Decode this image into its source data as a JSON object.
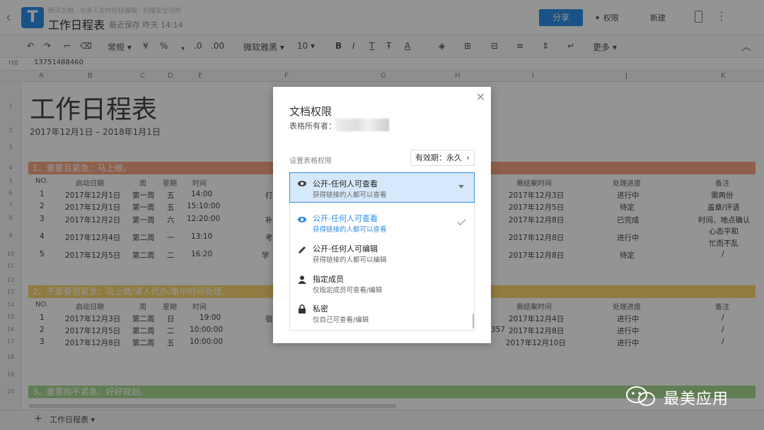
{
  "header": {
    "breadcrumb": "腾讯文档 · 与多人实时在线编辑 · 扫描安全可控",
    "title": "工作日程表",
    "save_status": "最近保存 昨天 14:14",
    "share_label": "分享",
    "permission_label": "权限",
    "new_label": "新建"
  },
  "toolbar": {
    "format": "常规",
    "currency": "¥",
    "percent": "%",
    "comma": "❟",
    "dec_decrease": ".0",
    "dec_increase": ".00",
    "font": "微软雅黑",
    "font_size": "10",
    "bold": "B",
    "italic": "I",
    "underline": "T",
    "strike": "Ŧ",
    "font_color": "A",
    "more": "更多"
  },
  "formula_bar": {
    "cell_ref": "H8",
    "value": "13751488460"
  },
  "columns": [
    "A",
    "B",
    "C",
    "D",
    "E",
    "F",
    "G",
    "H",
    "I",
    "J",
    "K"
  ],
  "rows": [
    "1",
    "2",
    "3",
    "4",
    "5",
    "6",
    "7",
    "8",
    "9",
    "10",
    "11",
    "12",
    "13",
    "14",
    "15",
    "16",
    "17",
    "18",
    "19",
    "20"
  ],
  "sheet": {
    "title": "工作日程表",
    "range": "2017年12月1日 – 2018年1月1日",
    "section1": "1、重要且紧急：马上做。",
    "section2": "2、不重要但紧急：马上做/请人代办/集中时间处理。",
    "section3": "3、重要而不紧急：好好规划。",
    "headers": {
      "no": "NO.",
      "start": "启动日期",
      "week": "周",
      "weekday": "星期",
      "time": "时间",
      "due": "需结案时间",
      "progress": "处理进度",
      "note": "备注"
    },
    "table1": [
      {
        "no": "1",
        "start": "2017年12月1日",
        "week": "第一周",
        "weekday": "五",
        "time": "14:00",
        "f": "打",
        "due": "2017年12月3日",
        "progress": "进行中",
        "note": "需两份"
      },
      {
        "no": "2",
        "start": "2017年12月1日",
        "week": "第一周",
        "weekday": "五",
        "time": "15:10:00",
        "f": "",
        "due": "2017年12月5日",
        "progress": "待定",
        "note": "盖章/评语"
      },
      {
        "no": "3",
        "start": "2017年12月2日",
        "week": "第一周",
        "weekday": "六",
        "time": "12:20:00",
        "f": "补",
        "due": "2017年12月8日",
        "progress": "已完成",
        "note": "时间、地点确认"
      },
      {
        "no": "4",
        "start": "2017年12月4日",
        "week": "第二周",
        "weekday": "一",
        "time": "13:10",
        "f": "考",
        "due": "2017年12月8日",
        "progress": "进行中",
        "note": "心态平和",
        "note2": "忙而不乱"
      },
      {
        "no": "5",
        "start": "2017年12月5日",
        "week": "第二周",
        "weekday": "二",
        "time": "16:20",
        "f": "学",
        "due": "2017年12月8日",
        "progress": "待定",
        "note": "/"
      }
    ],
    "table2": [
      {
        "no": "1",
        "start": "2017年12月3日",
        "week": "第二周",
        "weekday": "日",
        "time": "19:00",
        "f": "宿",
        "h": "",
        "due": "2017年12月4日",
        "progress": "进行中",
        "note": "/"
      },
      {
        "no": "2",
        "start": "2017年12月5日",
        "week": "第二周",
        "weekday": "二",
        "time": "10:00:00",
        "f": "",
        "h": "357",
        "due": "2017年12月8日",
        "progress": "进行中",
        "note": "/"
      },
      {
        "no": "3",
        "start": "2017年12月8日",
        "week": "第二周",
        "weekday": "五",
        "time": "10:00:00",
        "f": "",
        "h": "",
        "due": "2017年12月10日",
        "progress": "进行中",
        "note": "/"
      }
    ]
  },
  "bottom": {
    "add": "+",
    "sheet_tab": "工作日程表"
  },
  "watermark": "最美应用",
  "dialog": {
    "title": "文档权限",
    "owner_label": "表格所有者：",
    "setting_label": "设置表格权限",
    "validity": "有效期：永久",
    "selected": {
      "title": "公开-任何人可查看",
      "desc": "获得链接的人都可以查看"
    },
    "options": [
      {
        "title": "公开-任何人可查看",
        "desc": "获得链接的人都可以查看",
        "icon": "eye-icon",
        "selected": true
      },
      {
        "title": "公开-任何人可编辑",
        "desc": "获得链接的人都可以编辑",
        "icon": "pencil-icon",
        "selected": false
      },
      {
        "title": "指定成员",
        "desc": "仅指定成员可查看/编辑",
        "icon": "person-icon",
        "selected": false
      },
      {
        "title": "私密",
        "desc": "仅自己可查看/编辑",
        "icon": "lock-icon",
        "selected": false
      }
    ]
  },
  "colors": {
    "accent": "#2f8ee6",
    "section1": "#f4a582",
    "section2": "#f9d56e",
    "section3": "#a8d890"
  }
}
